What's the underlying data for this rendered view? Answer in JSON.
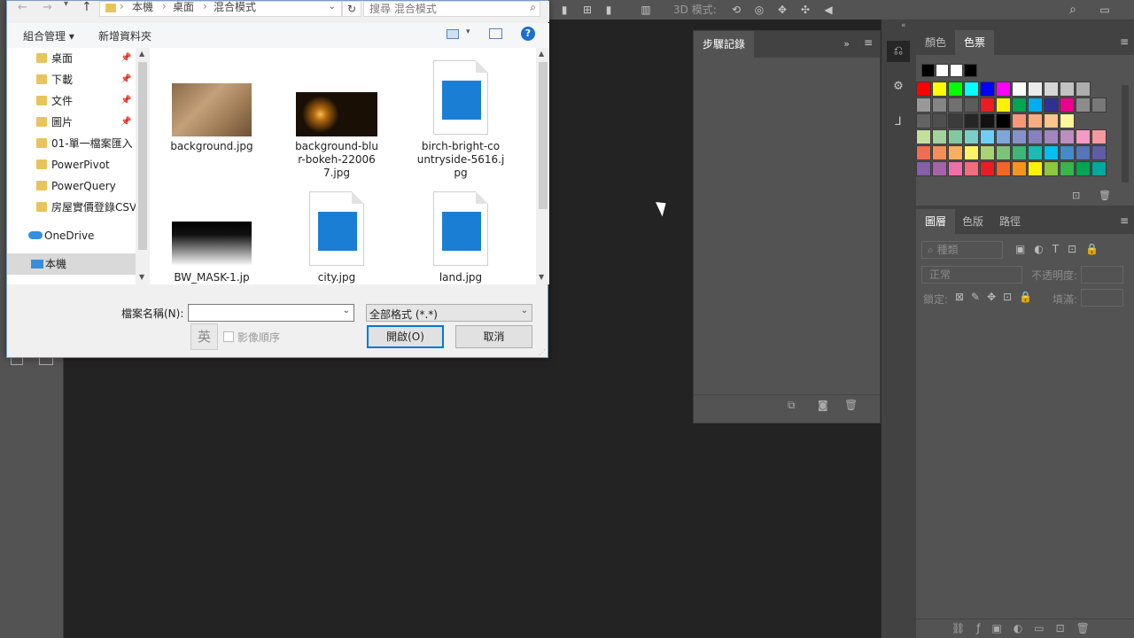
{
  "dialog": {
    "breadcrumb": [
      "本機",
      "桌面",
      "混合模式"
    ],
    "search_placeholder": "搜尋 混合模式",
    "cmd_organize": "組合管理 ▾",
    "cmd_new_folder": "新增資料夾",
    "nav": [
      {
        "label": "桌面",
        "pinned": true
      },
      {
        "label": "下載",
        "pinned": true
      },
      {
        "label": "文件",
        "pinned": true
      },
      {
        "label": "圖片",
        "pinned": true
      },
      {
        "label": "01-單一檔案匯入",
        "pinned": false
      },
      {
        "label": "PowerPivot",
        "pinned": false
      },
      {
        "label": "PowerQuery",
        "pinned": false
      },
      {
        "label": "房屋實價登錄CSV",
        "pinned": false
      }
    ],
    "onedrive": "OneDrive",
    "this_pc": "本機",
    "files": [
      {
        "name": "background.jpg"
      },
      {
        "name": "background-blu\nr-bokeh-22006\n7.jpg"
      },
      {
        "name": "birch-bright-co\nuntryside-5616.j\npg"
      },
      {
        "name": "BW_MASK-1.jp"
      },
      {
        "name": "city.jpg"
      },
      {
        "name": "land.jpg"
      }
    ],
    "filename_label": "檔案名稱(N):",
    "filename_value": "",
    "filetype_value": "全部格式 (*.*)",
    "ime_label": "英",
    "image_sequence_label": "影像順序",
    "open_button": "開啟(O)",
    "cancel_button": "取消"
  },
  "photoshop": {
    "options_3d_label": "3D 模式:",
    "history_tab": "步驟記錄",
    "swatch_tabs": [
      "顏色",
      "色票"
    ],
    "layer_tabs": [
      "圖層",
      "色版",
      "路徑"
    ],
    "layer_filter": "種類",
    "blend_mode": "正常",
    "opacity_label": "不透明度:",
    "lock_label": "鎖定:",
    "fill_label": "填滿:",
    "swatch_top_colors": [
      "#000000",
      "#ffffff",
      "#ffffff",
      "#000000"
    ],
    "swatch_rows": [
      [
        "#ff0000",
        "#ffff00",
        "#00ff00",
        "#00ffff",
        "#0000ff",
        "#ff00ff",
        "#ffffff",
        "#ebebeb",
        "#d6d6d6",
        "#c2c2c2",
        "#adadad"
      ],
      [
        "#999999",
        "#858585",
        "#707070",
        "#5c5c5c",
        "#ed1c24",
        "#fff200",
        "#00a651",
        "#00aeef",
        "#2e3192",
        "#ec008c",
        "#8c8c8c",
        "#787878"
      ],
      [
        "#636363",
        "#4f4f4f",
        "#3b3b3b",
        "#262626",
        "#121212",
        "#000000",
        "#f7977a",
        "#f9ad81",
        "#fdc68a",
        "#fff79a"
      ],
      [
        "#c4df9b",
        "#a3d39c",
        "#82ca9d",
        "#7bcdc8",
        "#6dcff6",
        "#7da7d9",
        "#8393ca",
        "#8781bd",
        "#a187be",
        "#bc8dbf",
        "#f49ac2",
        "#f6989d"
      ],
      [
        "#f26c4f",
        "#f68e55",
        "#fbaf5c",
        "#fff467",
        "#acd372",
        "#7cc576",
        "#3bb878",
        "#1abbb4",
        "#00bff3",
        "#438cca",
        "#5574b9",
        "#605ca8"
      ],
      [
        "#855fa8",
        "#a763a8",
        "#f06eaa",
        "#f26d7d",
        "#ed1c24",
        "#f26522",
        "#f7941d",
        "#fff200",
        "#8dc63f",
        "#39b54a",
        "#00a651",
        "#00a99d"
      ]
    ]
  }
}
